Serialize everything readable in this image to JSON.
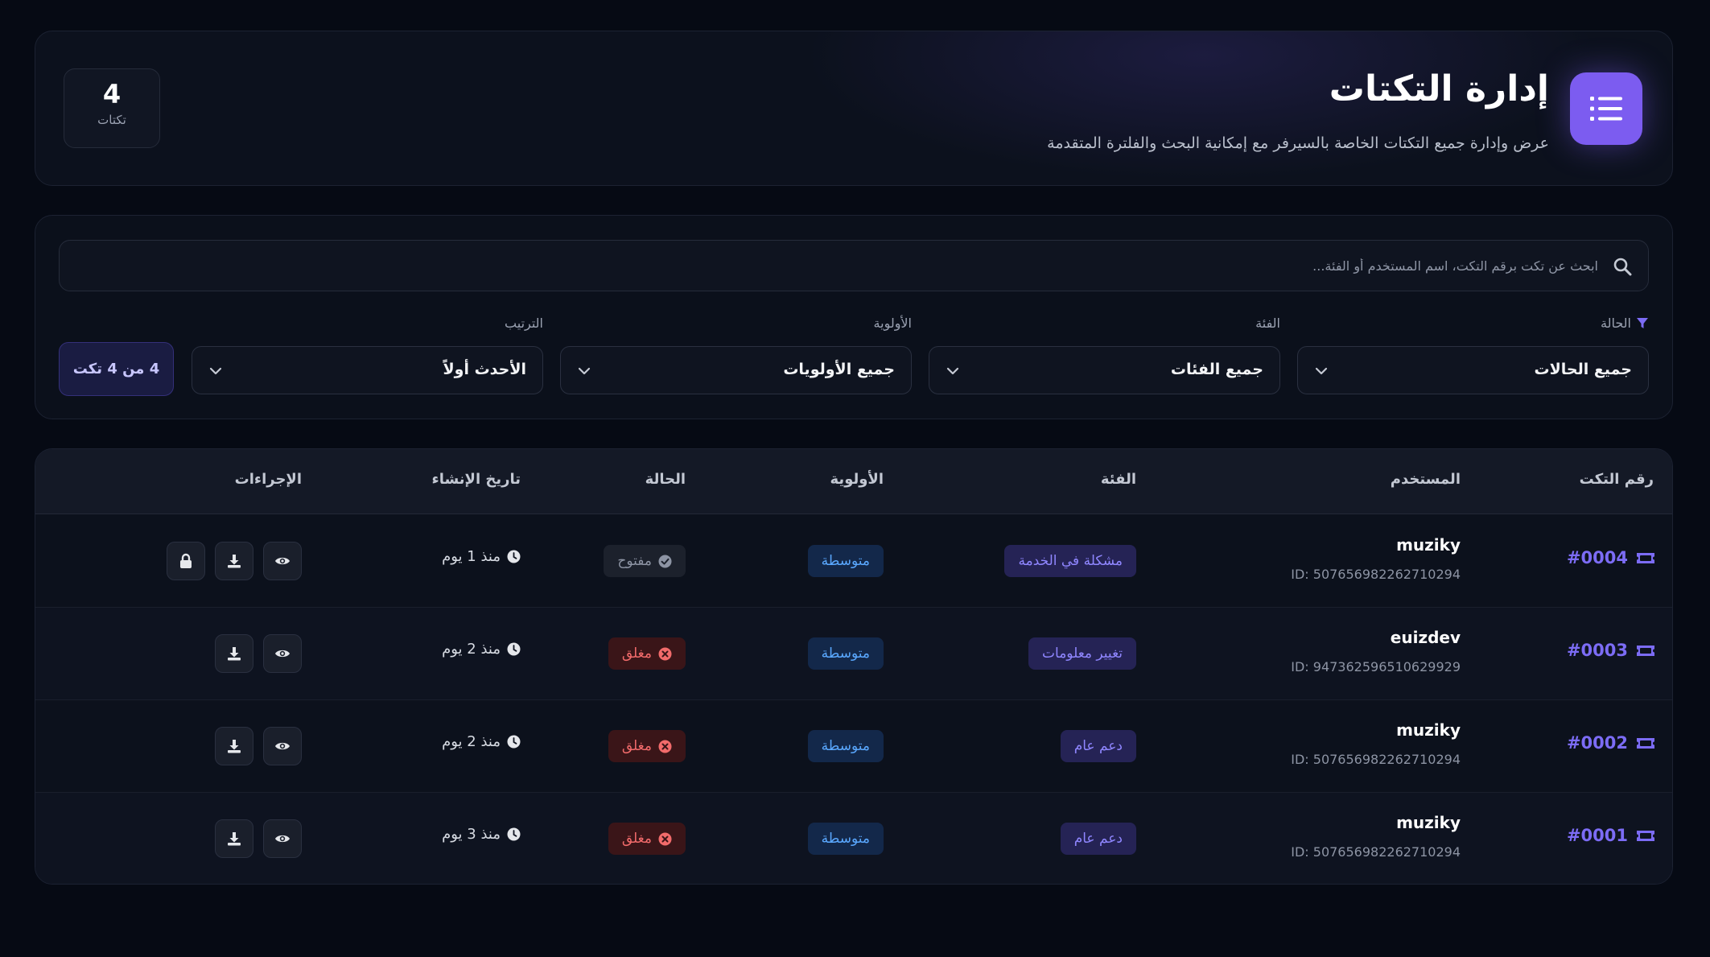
{
  "header": {
    "title": "إدارة التكتات",
    "subtitle": "عرض وإدارة جميع التكتات الخاصة بالسيرفر مع إمكانية البحث والفلترة المتقدمة",
    "count_value": "4",
    "count_label": "تكتات",
    "icon": "list-icon"
  },
  "filters": {
    "search_placeholder": "ابحث عن تكت برقم التكت، اسم المستخدم أو الفئة...",
    "status_label": "الحالة",
    "status_value": "جميع الحالات",
    "category_label": "الفئة",
    "category_value": "جميع الفئات",
    "priority_label": "الأولوية",
    "priority_value": "جميع الأولويات",
    "sort_label": "الترتيب",
    "sort_value": "الأحدث أولاً",
    "result_count": "4 من 4 تكت"
  },
  "table": {
    "headers": {
      "ticket_number": "رقم التكت",
      "user": "المستخدم",
      "category": "الفئة",
      "priority": "الأولوية",
      "status": "الحالة",
      "created": "تاريخ الإنشاء",
      "actions": "الإجراءات"
    },
    "rows": [
      {
        "id": "#0004",
        "user": "muziky",
        "user_id": "ID: 507656982262710294",
        "category": "مشكلة في الخدمة",
        "priority": "متوسطة",
        "status": "مفتوح",
        "status_kind": "open",
        "created": "منذ 1 يوم"
      },
      {
        "id": "#0003",
        "user": "euizdev",
        "user_id": "ID: 947362596510629929",
        "category": "تغيير معلومات",
        "priority": "متوسطة",
        "status": "مغلق",
        "status_kind": "closed",
        "created": "منذ 2 يوم"
      },
      {
        "id": "#0002",
        "user": "muziky",
        "user_id": "ID: 507656982262710294",
        "category": "دعم عام",
        "priority": "متوسطة",
        "status": "مغلق",
        "status_kind": "closed",
        "created": "منذ 2 يوم"
      },
      {
        "id": "#0001",
        "user": "muziky",
        "user_id": "ID: 507656982262710294",
        "category": "دعم عام",
        "priority": "متوسطة",
        "status": "مغلق",
        "status_kind": "closed",
        "created": "منذ 3 يوم"
      }
    ]
  },
  "colors": {
    "accent": "#7c5cf0",
    "ticket_id": "#7c6cf5",
    "closed": "#f26b6b",
    "priority": "#5aa8ff"
  }
}
